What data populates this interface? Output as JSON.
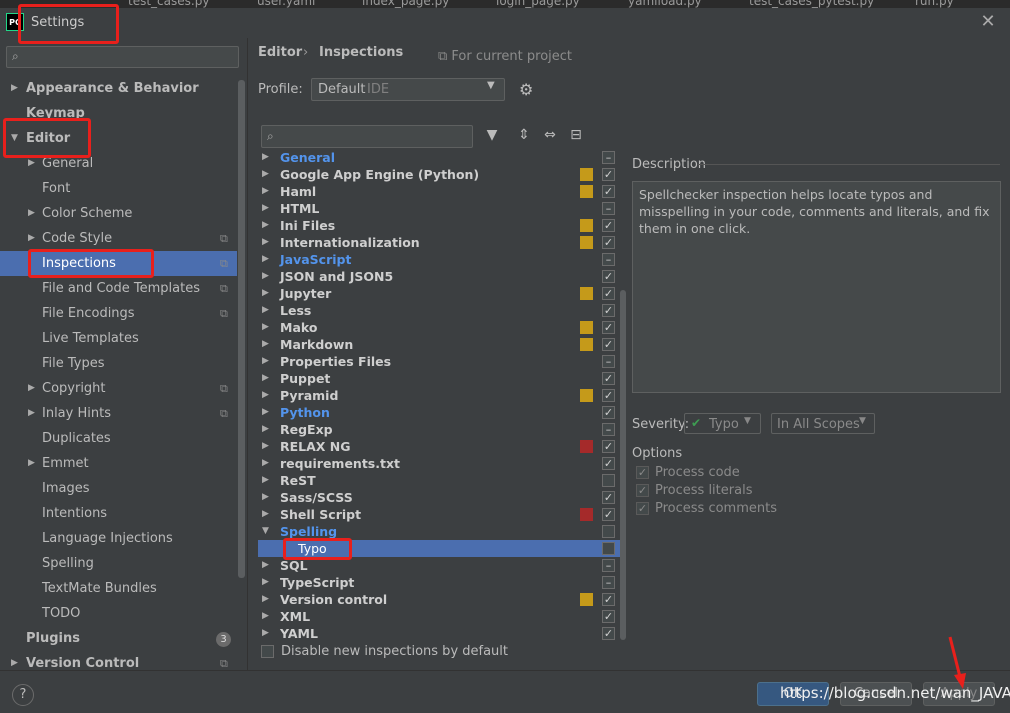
{
  "window": {
    "title": "Settings",
    "logo_text": "PC",
    "close_label": "✕"
  },
  "tab_strip": [
    "test_cases.py",
    "user.yaml",
    "index_page.py",
    "login_page.py",
    "yamlload.py",
    "test_cases_pytest.py",
    "run.py"
  ],
  "left_tree": {
    "search_icon": "⌕",
    "items": [
      {
        "label": "Appearance & Behavior",
        "bold": true
      },
      {
        "label": "Keymap",
        "bold": true
      },
      {
        "label": "Editor",
        "bold": true
      },
      {
        "label": "General"
      },
      {
        "label": "Font"
      },
      {
        "label": "Color Scheme"
      },
      {
        "label": "Code Style"
      },
      {
        "label": "Inspections"
      },
      {
        "label": "File and Code Templates"
      },
      {
        "label": "File Encodings"
      },
      {
        "label": "Live Templates"
      },
      {
        "label": "File Types"
      },
      {
        "label": "Copyright"
      },
      {
        "label": "Inlay Hints"
      },
      {
        "label": "Duplicates"
      },
      {
        "label": "Emmet"
      },
      {
        "label": "Images"
      },
      {
        "label": "Intentions"
      },
      {
        "label": "Language Injections"
      },
      {
        "label": "Spelling"
      },
      {
        "label": "TextMate Bundles"
      },
      {
        "label": "TODO"
      },
      {
        "label": "Plugins",
        "bold": true
      },
      {
        "label": "Version Control",
        "bold": true
      }
    ],
    "plugins_badge": "3"
  },
  "header": {
    "breadcrumb_editor": "Editor",
    "breadcrumb_sep": "›",
    "breadcrumb_current": "Inspections",
    "for_project": "For current project",
    "profile_label": "Profile:",
    "profile_value": "Default",
    "profile_sub": "IDE"
  },
  "inspections": [
    {
      "label": "General",
      "blue": true,
      "sev": "",
      "chk": "minus"
    },
    {
      "label": "Google App Engine (Python)",
      "sev": "#c59a1a",
      "chk": "check"
    },
    {
      "label": "Haml",
      "sev": "#c59a1a",
      "chk": "check"
    },
    {
      "label": "HTML",
      "sev": "",
      "chk": "minus"
    },
    {
      "label": "Ini Files",
      "sev": "#c59a1a",
      "chk": "check"
    },
    {
      "label": "Internationalization",
      "sev": "#c59a1a",
      "chk": "check"
    },
    {
      "label": "JavaScript",
      "blue": true,
      "sev": "",
      "chk": "minus"
    },
    {
      "label": "JSON and JSON5",
      "sev": "",
      "chk": "check"
    },
    {
      "label": "Jupyter",
      "sev": "#c59a1a",
      "chk": "check"
    },
    {
      "label": "Less",
      "sev": "",
      "chk": "check"
    },
    {
      "label": "Mako",
      "sev": "#c59a1a",
      "chk": "check"
    },
    {
      "label": "Markdown",
      "sev": "#c59a1a",
      "chk": "check"
    },
    {
      "label": "Properties Files",
      "sev": "",
      "chk": "minus"
    },
    {
      "label": "Puppet",
      "sev": "",
      "chk": "check"
    },
    {
      "label": "Pyramid",
      "sev": "#c59a1a",
      "chk": "check"
    },
    {
      "label": "Python",
      "blue": true,
      "sev": "",
      "chk": "check"
    },
    {
      "label": "RegExp",
      "sev": "",
      "chk": "minus"
    },
    {
      "label": "RELAX NG",
      "sev": "#a52a2a",
      "chk": "check"
    },
    {
      "label": "requirements.txt",
      "sev": "",
      "chk": "check"
    },
    {
      "label": "ReST",
      "sev": "",
      "chk": "none"
    },
    {
      "label": "Sass/SCSS",
      "sev": "",
      "chk": "check"
    },
    {
      "label": "Shell Script",
      "sev": "#a52a2a",
      "chk": "check"
    },
    {
      "label": "Spelling",
      "blue": true,
      "sev": "",
      "chk": "none",
      "expanded": true
    },
    {
      "label": "Typo",
      "child": true,
      "sev": "",
      "chk": "none",
      "selected": true
    },
    {
      "label": "SQL",
      "sev": "",
      "chk": "minus"
    },
    {
      "label": "TypeScript",
      "sev": "",
      "chk": "minus"
    },
    {
      "label": "Version control",
      "sev": "#c59a1a",
      "chk": "check"
    },
    {
      "label": "XML",
      "sev": "",
      "chk": "check"
    },
    {
      "label": "YAML",
      "sev": "",
      "chk": "check"
    }
  ],
  "disable_new_label": "Disable new inspections by default",
  "description": {
    "title": "Description",
    "text": "Spellchecker inspection helps locate typos and misspelling in your code, comments and literals, and fix them in one click.",
    "severity_label": "Severity:",
    "severity_value": "Typo",
    "scope_value": "In All Scopes",
    "options_label": "Options",
    "options": [
      "Process code",
      "Process literals",
      "Process comments"
    ]
  },
  "footer": {
    "help": "?",
    "ok": "OK",
    "cancel": "Cancel",
    "apply": "Apply",
    "watermark": "https://blog.csdn.net/wan_JAVA"
  },
  "colors": {
    "accent": "#4b6eaf",
    "annotation": "#e8201c",
    "link_blue": "#5394ec"
  }
}
